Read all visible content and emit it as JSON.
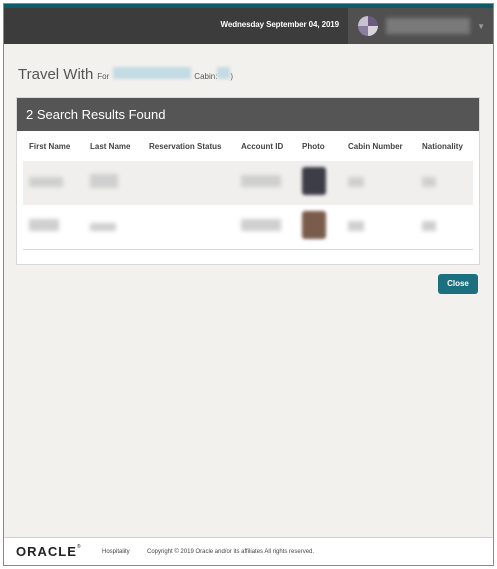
{
  "header": {
    "date": "Wednesday September 04, 2019",
    "user_icon": "user-avatar-icon",
    "dropdown_icon": "caret-down-icon"
  },
  "page": {
    "title": "Travel With",
    "for_label": "For",
    "cabin_label": "Cabin:"
  },
  "results": {
    "heading": "2 Search Results Found",
    "columns": [
      "First Name",
      "Last Name",
      "Reservation Status",
      "Account ID",
      "Photo",
      "Cabin Number",
      "Nationality"
    ]
  },
  "actions": {
    "close_label": "Close"
  },
  "footer": {
    "logo": "ORACLE",
    "registered": "®",
    "division": "Hospitality",
    "copyright": "Copyright © 2019 Oracle and/or its affiliates All rights reserved."
  },
  "colors": {
    "accent": "#1b6f7e",
    "header_bg": "#3c3c3c",
    "panel_header_bg": "#555555"
  }
}
